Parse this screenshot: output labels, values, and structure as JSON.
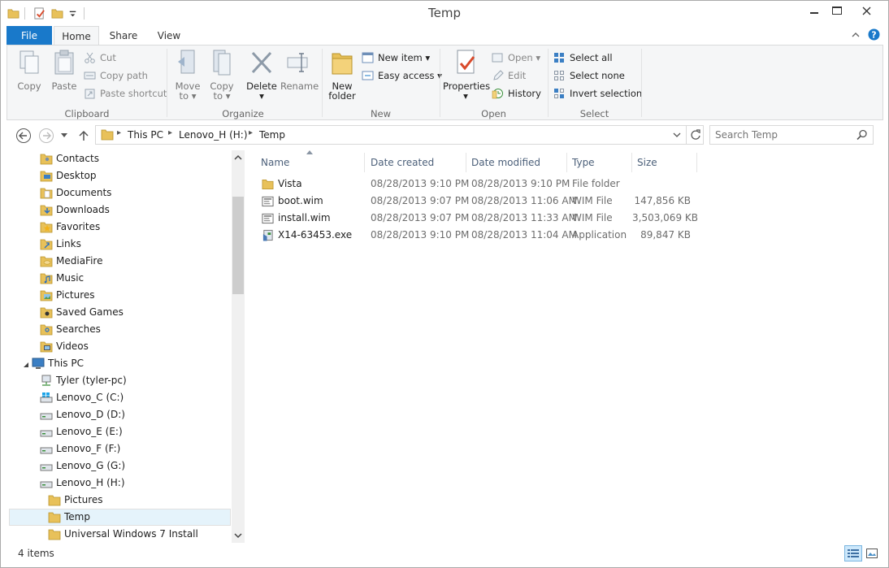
{
  "window": {
    "title": "Temp"
  },
  "ribbon_tabs": {
    "file": "File",
    "home": "Home",
    "share": "Share",
    "view": "View"
  },
  "clipboard": {
    "label": "Clipboard",
    "copy": "Copy",
    "paste": "Paste",
    "cut": "Cut",
    "copy_path": "Copy path",
    "paste_shortcut": "Paste shortcut"
  },
  "organize": {
    "label": "Organize",
    "move_to_1": "Move",
    "move_to_2": "to",
    "copy_to_1": "Copy",
    "copy_to_2": "to",
    "delete": "Delete",
    "rename": "Rename"
  },
  "new_group": {
    "label": "New",
    "new_folder_1": "New",
    "new_folder_2": "folder",
    "new_item": "New item",
    "easy_access": "Easy access"
  },
  "open_group": {
    "label": "Open",
    "properties": "Properties",
    "open": "Open",
    "edit": "Edit",
    "history": "History"
  },
  "select_group": {
    "label": "Select",
    "select_all": "Select all",
    "select_none": "Select none",
    "invert_selection": "Invert selection"
  },
  "address": {
    "crumbs": [
      "This PC",
      "Lenovo_H (H:)",
      "Temp"
    ]
  },
  "search": {
    "placeholder": "Search Temp"
  },
  "nav_tree": [
    {
      "label": "Contacts",
      "icon": "contacts-folder-icon"
    },
    {
      "label": "Desktop",
      "icon": "desktop-folder-icon"
    },
    {
      "label": "Documents",
      "icon": "documents-folder-icon"
    },
    {
      "label": "Downloads",
      "icon": "downloads-folder-icon"
    },
    {
      "label": "Favorites",
      "icon": "favorites-folder-icon"
    },
    {
      "label": "Links",
      "icon": "links-folder-icon"
    },
    {
      "label": "MediaFire",
      "icon": "mediafire-folder-icon"
    },
    {
      "label": "Music",
      "icon": "music-folder-icon"
    },
    {
      "label": "Pictures",
      "icon": "pictures-folder-icon"
    },
    {
      "label": "Saved Games",
      "icon": "saved-games-folder-icon"
    },
    {
      "label": "Searches",
      "icon": "searches-folder-icon"
    },
    {
      "label": "Videos",
      "icon": "videos-folder-icon"
    },
    {
      "label": "This PC",
      "icon": "computer-icon"
    },
    {
      "label": "Tyler (tyler-pc)",
      "icon": "network-drive-icon"
    },
    {
      "label": "Lenovo_C (C:)",
      "icon": "windows-drive-icon"
    },
    {
      "label": "Lenovo_D (D:)",
      "icon": "drive-icon"
    },
    {
      "label": "Lenovo_E (E:)",
      "icon": "drive-icon"
    },
    {
      "label": "Lenovo_F (F:)",
      "icon": "drive-icon"
    },
    {
      "label": "Lenovo_G (G:)",
      "icon": "drive-icon"
    },
    {
      "label": "Lenovo_H (H:)",
      "icon": "drive-icon"
    },
    {
      "label": "Pictures",
      "icon": "folder-icon"
    },
    {
      "label": "Temp",
      "icon": "folder-icon"
    },
    {
      "label": "Universal Windows 7 Install",
      "icon": "folder-icon"
    }
  ],
  "columns": {
    "name": "Name",
    "date_created": "Date created",
    "date_modified": "Date modified",
    "type": "Type",
    "size": "Size"
  },
  "files": [
    {
      "name": "Vista",
      "created": "08/28/2013 9:10 PM",
      "modified": "08/28/2013 9:10 PM",
      "type": "File folder",
      "size": "",
      "icon": "folder-icon"
    },
    {
      "name": "boot.wim",
      "created": "08/28/2013 9:07 PM",
      "modified": "08/28/2013 11:06 AM",
      "type": "WIM File",
      "size": "147,856 KB",
      "icon": "wim-file-icon"
    },
    {
      "name": "install.wim",
      "created": "08/28/2013 9:07 PM",
      "modified": "08/28/2013 11:33 AM",
      "type": "WIM File",
      "size": "3,503,069 KB",
      "icon": "wim-file-icon"
    },
    {
      "name": "X14-63453.exe",
      "created": "08/28/2013 9:10 PM",
      "modified": "08/28/2013 11:04 AM",
      "type": "Application",
      "size": "89,847 KB",
      "icon": "setup-exe-icon"
    }
  ],
  "status": {
    "item_count": "4 items"
  },
  "colors": {
    "file_tab": "#1979ca",
    "ribbon_bg": "#f5f6f7",
    "folder": "#e8c15a",
    "selection": "#e5f3fb"
  }
}
